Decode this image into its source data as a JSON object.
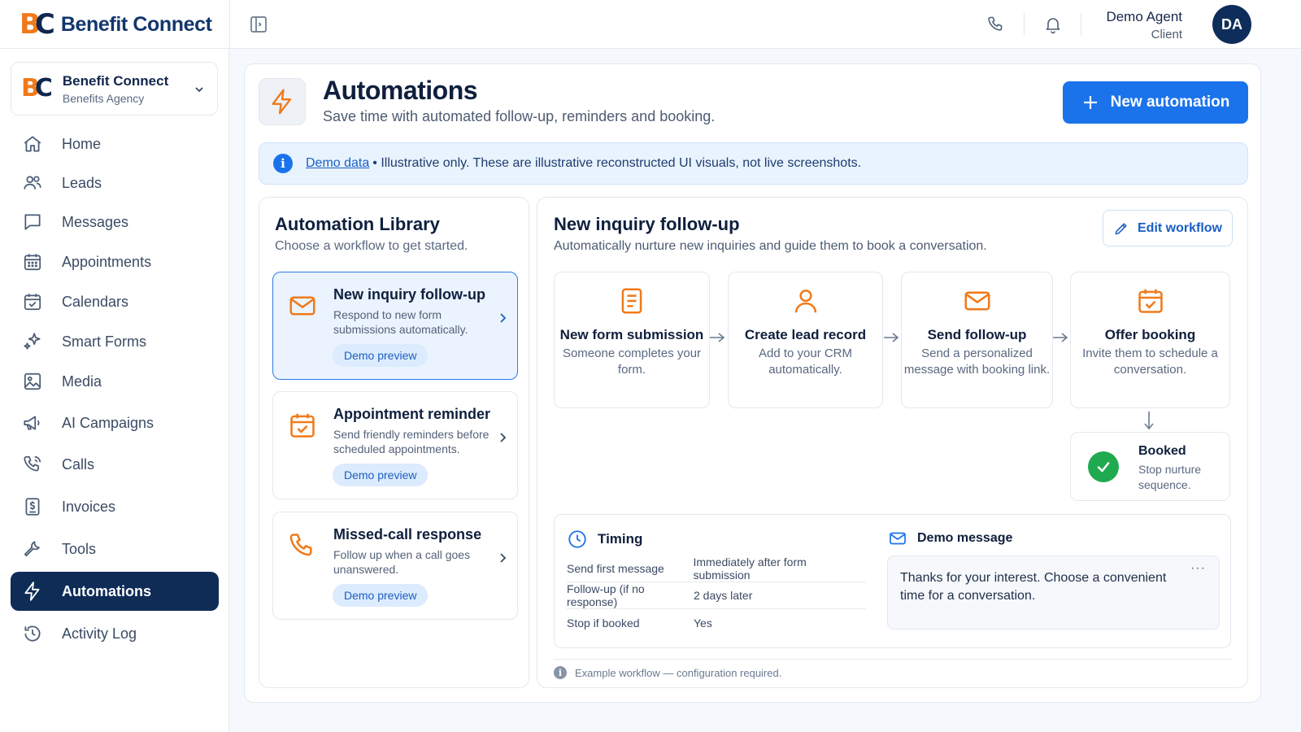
{
  "brand": {
    "logo_b": "B",
    "logo_c": "C",
    "name": "Benefit Connect"
  },
  "user": {
    "name": "Demo Agent",
    "role": "Client",
    "initials": "DA"
  },
  "org": {
    "name": "Benefit Connect",
    "subtitle": "Benefits Agency"
  },
  "nav": [
    {
      "label": "Home",
      "icon": "home-icon"
    },
    {
      "label": "Leads",
      "icon": "users-icon"
    },
    {
      "label": "Messages",
      "icon": "message-icon"
    },
    {
      "label": "Appointments",
      "icon": "calendar-grid-icon"
    },
    {
      "label": "Calendars",
      "icon": "calendar-check-icon"
    },
    {
      "label": "Smart Forms",
      "icon": "sparkle-icon"
    },
    {
      "label": "Media",
      "icon": "image-icon"
    },
    {
      "label": "AI Campaigns",
      "icon": "megaphone-icon"
    },
    {
      "label": "Calls",
      "icon": "phone-icon"
    },
    {
      "label": "Invoices",
      "icon": "invoice-icon"
    },
    {
      "label": "Tools",
      "icon": "wrench-icon"
    },
    {
      "label": "Automations",
      "icon": "lightning-icon",
      "active": true
    },
    {
      "label": "Activity Log",
      "icon": "history-icon"
    }
  ],
  "page": {
    "title": "Automations",
    "subtitle": "Save time with automated follow-up, reminders and booking.",
    "new_button": "New automation"
  },
  "banner": {
    "link": "Demo data",
    "text": "• Illustrative only. These are illustrative reconstructed UI visuals, not live screenshots."
  },
  "library": {
    "title": "Automation Library",
    "subtitle": "Choose a workflow to get started.",
    "items": [
      {
        "name": "New inquiry follow-up",
        "desc": "Respond to new form submissions automatically.",
        "chip": "Demo preview",
        "icon": "envelope-icon",
        "selected": true
      },
      {
        "name": "Appointment reminder",
        "desc": "Send friendly reminders before scheduled appointments.",
        "chip": "Demo preview",
        "icon": "calendar-check-icon"
      },
      {
        "name": "Missed-call response",
        "desc": "Follow up when a call goes unanswered.",
        "chip": "Demo preview",
        "icon": "phone-icon"
      }
    ]
  },
  "workflow": {
    "title": "New inquiry follow-up",
    "subtitle": "Automatically nurture new inquiries and guide them to book a conversation.",
    "edit_button": "Edit workflow",
    "steps": [
      {
        "title": "New form submission",
        "desc": "Someone completes your form.",
        "icon": "form-icon"
      },
      {
        "title": "Create lead record",
        "desc": "Add to your CRM automatically.",
        "icon": "person-icon"
      },
      {
        "title": "Send follow-up",
        "desc": "Send a personalized message with booking link.",
        "icon": "envelope-icon"
      },
      {
        "title": "Offer booking",
        "desc": "Invite them to schedule a conversation.",
        "icon": "calendar-check-icon"
      }
    ],
    "booked": {
      "title": "Booked",
      "desc": "Stop nurture sequence."
    },
    "timing": {
      "title": "Timing",
      "rows": [
        {
          "key": "Send first message",
          "value": "Immediately after form submission"
        },
        {
          "key": "Follow-up (if no response)",
          "value": "2 days later"
        },
        {
          "key": "Stop if booked",
          "value": "Yes"
        }
      ]
    },
    "message": {
      "title": "Demo message",
      "text": "Thanks for your interest. Choose a convenient time for a conversation.",
      "more": "···"
    },
    "footer_note": "Example workflow — configuration required."
  },
  "colors": {
    "accent": "#1a73ea",
    "brand_orange": "#f07a1a",
    "navy": "#0f2c57",
    "success": "#1faa4f"
  }
}
